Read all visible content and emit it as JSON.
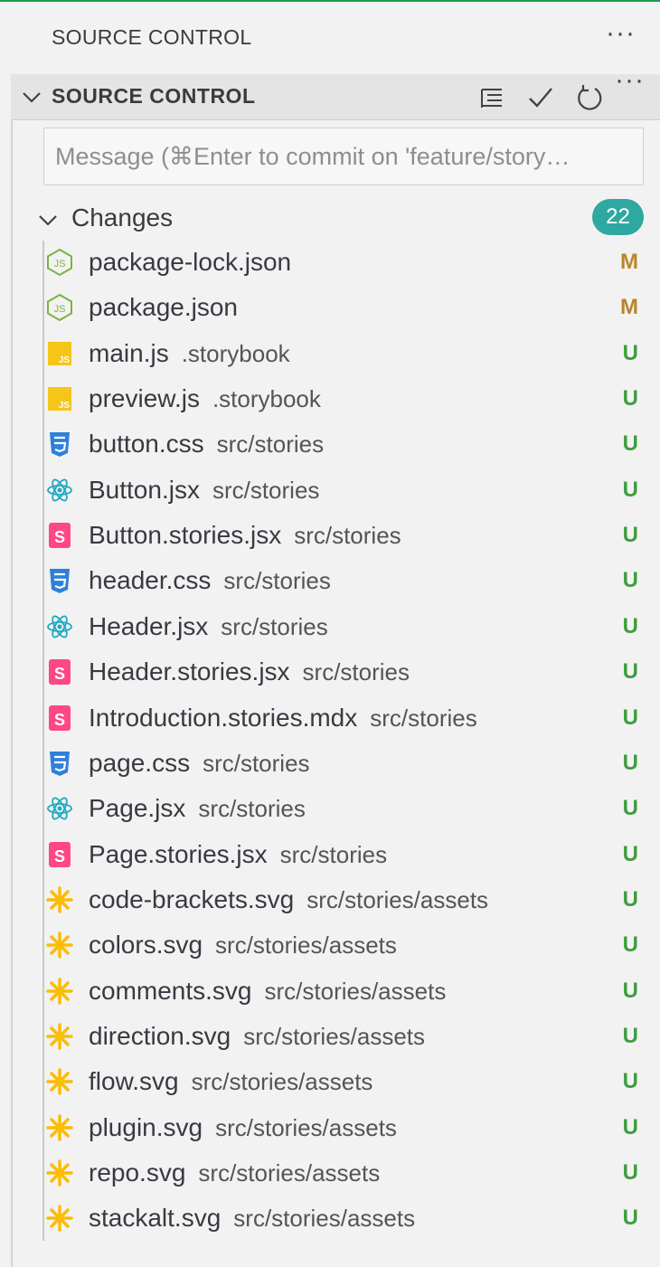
{
  "panel": {
    "title": "SOURCE CONTROL",
    "more_label": "···"
  },
  "section": {
    "title": "SOURCE CONTROL",
    "more_label": "···"
  },
  "commit": {
    "placeholder": "Message (⌘Enter to commit on 'feature/story…"
  },
  "changes": {
    "label": "Changes",
    "count": "22",
    "badge_color": "#2ea8a0"
  },
  "status_colors": {
    "M": "#b8862a",
    "U": "#3f9d3f"
  },
  "files": [
    {
      "name": "package-lock.json",
      "dir": "",
      "status": "M",
      "icon": "node-icon"
    },
    {
      "name": "package.json",
      "dir": "",
      "status": "M",
      "icon": "node-icon"
    },
    {
      "name": "main.js",
      "dir": ".storybook",
      "status": "U",
      "icon": "js-icon"
    },
    {
      "name": "preview.js",
      "dir": ".storybook",
      "status": "U",
      "icon": "js-icon"
    },
    {
      "name": "button.css",
      "dir": "src/stories",
      "status": "U",
      "icon": "css-icon"
    },
    {
      "name": "Button.jsx",
      "dir": "src/stories",
      "status": "U",
      "icon": "react-icon"
    },
    {
      "name": "Button.stories.jsx",
      "dir": "src/stories",
      "status": "U",
      "icon": "storybook-icon"
    },
    {
      "name": "header.css",
      "dir": "src/stories",
      "status": "U",
      "icon": "css-icon"
    },
    {
      "name": "Header.jsx",
      "dir": "src/stories",
      "status": "U",
      "icon": "react-icon"
    },
    {
      "name": "Header.stories.jsx",
      "dir": "src/stories",
      "status": "U",
      "icon": "storybook-icon"
    },
    {
      "name": "Introduction.stories.mdx",
      "dir": "src/stories",
      "status": "U",
      "icon": "storybook-icon"
    },
    {
      "name": "page.css",
      "dir": "src/stories",
      "status": "U",
      "icon": "css-icon"
    },
    {
      "name": "Page.jsx",
      "dir": "src/stories",
      "status": "U",
      "icon": "react-icon"
    },
    {
      "name": "Page.stories.jsx",
      "dir": "src/stories",
      "status": "U",
      "icon": "storybook-icon"
    },
    {
      "name": "code-brackets.svg",
      "dir": "src/stories/assets",
      "status": "U",
      "icon": "svg-icon"
    },
    {
      "name": "colors.svg",
      "dir": "src/stories/assets",
      "status": "U",
      "icon": "svg-icon"
    },
    {
      "name": "comments.svg",
      "dir": "src/stories/assets",
      "status": "U",
      "icon": "svg-icon"
    },
    {
      "name": "direction.svg",
      "dir": "src/stories/assets",
      "status": "U",
      "icon": "svg-icon"
    },
    {
      "name": "flow.svg",
      "dir": "src/stories/assets",
      "status": "U",
      "icon": "svg-icon"
    },
    {
      "name": "plugin.svg",
      "dir": "src/stories/assets",
      "status": "U",
      "icon": "svg-icon"
    },
    {
      "name": "repo.svg",
      "dir": "src/stories/assets",
      "status": "U",
      "icon": "svg-icon"
    },
    {
      "name": "stackalt.svg",
      "dir": "src/stories/assets",
      "status": "U",
      "icon": "svg-icon"
    }
  ]
}
